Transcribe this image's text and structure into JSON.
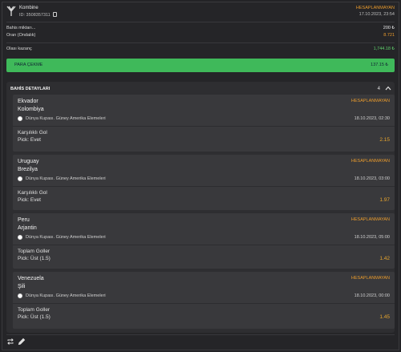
{
  "header": {
    "type": "Kombine",
    "id_label": "ID: 3508357311",
    "status": "HESAPLANMAYAN",
    "date": "17.10.2023, 23:54",
    "icons": {
      "logo": "y-logo-icon",
      "copy": "copy-icon"
    }
  },
  "summary": {
    "stake_label": "Bahis miktarı...",
    "stake_value": "200 ₺",
    "odds_label": "Oran (Ondalık)",
    "odds_value": "8.721",
    "potential_label": "Olası kazanç",
    "potential_value": "1,744.18 ₺"
  },
  "cashout": {
    "label": "PARA ÇEKME",
    "value": "137.15 ₺"
  },
  "details": {
    "title": "BAHİS DETAYLARI",
    "count": "4",
    "selections": [
      {
        "home": "Ekvador",
        "away": "Kolombiya",
        "status": "HESAPLANMAYAN",
        "competition": "Dünya Kupası. Güney Amerika Elemeleri",
        "date": "18.10.2023, 02:30",
        "market": "Karşılıklı Gol",
        "pick": "Pick: Evet",
        "odd": "2.15"
      },
      {
        "home": "Uruguay",
        "away": "Brezilya",
        "status": "HESAPLANMAYAN",
        "competition": "Dünya Kupası. Güney Amerika Elemeleri",
        "date": "18.10.2023, 03:00",
        "market": "Karşılıklı Gol",
        "pick": "Pick: Evet",
        "odd": "1.97"
      },
      {
        "home": "Peru",
        "away": "Arjantin",
        "status": "HESAPLANMAYAN",
        "competition": "Dünya Kupası. Güney Amerika Elemeleri",
        "date": "18.10.2023, 05:00",
        "market": "Toplam Goller",
        "pick": "Pick: Üst (1.5)",
        "odd": "1.42"
      },
      {
        "home": "Venezuela",
        "away": "Şili",
        "status": "HESAPLANMAYAN",
        "competition": "Dünya Kupası. Güney Amerika Elemeleri",
        "date": "18.10.2023, 00:00",
        "market": "Toplam Goller",
        "pick": "Pick: Üst (1.5)",
        "odd": "1.45"
      }
    ]
  },
  "colors": {
    "accent_status": "#e89a2c",
    "cashout_green": "#3fb95a",
    "potential_green": "#5fcf6c"
  },
  "footer_icons": [
    "repeat-icon",
    "edit-pencil-icon"
  ]
}
